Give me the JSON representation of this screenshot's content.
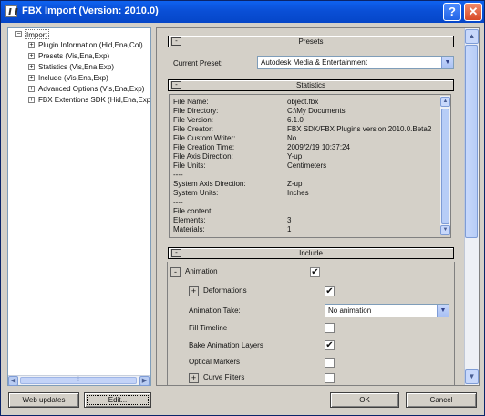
{
  "window": {
    "title": "FBX Import (Version: 2010.0)",
    "help_glyph": "?",
    "close_glyph": "✕"
  },
  "tree": {
    "root": {
      "label": "Import",
      "toggle": "−"
    },
    "items": [
      {
        "label": "Plugin Information (Hid,Ena,Col)",
        "toggle": "+"
      },
      {
        "label": "Presets (Vis,Ena,Exp)",
        "toggle": "+"
      },
      {
        "label": "Statistics (Vis,Ena,Exp)",
        "toggle": "+"
      },
      {
        "label": "Include (Vis,Ena,Exp)",
        "toggle": "+"
      },
      {
        "label": "Advanced Options (Vis,Ena,Exp)",
        "toggle": "+"
      },
      {
        "label": "FBX Extentions SDK (Hid,Ena,Exp",
        "toggle": "+"
      }
    ]
  },
  "presets": {
    "title": "Presets",
    "collapse": "-",
    "current_label": "Current Preset:",
    "current_value": "Autodesk Media & Entertainment"
  },
  "statistics": {
    "title": "Statistics",
    "collapse": "-",
    "rows": [
      {
        "label": "File Name:",
        "value": "object.fbx"
      },
      {
        "label": "File Directory:",
        "value": "C:\\My Documents"
      },
      {
        "label": "File Version:",
        "value": "6.1.0"
      },
      {
        "label": "File Creator:",
        "value": "FBX SDK/FBX Plugins version 2010.0.Beta2"
      },
      {
        "label": "File Custom Writer:",
        "value": "No"
      },
      {
        "label": "File Creation Time:",
        "value": "2009/2/19  10:37:24"
      },
      {
        "label": "File Axis Direction:",
        "value": "Y-up"
      },
      {
        "label": "File Units:",
        "value": "Centimeters"
      },
      {
        "label": "----",
        "value": ""
      },
      {
        "label": "System Axis Direction:",
        "value": "Z-up"
      },
      {
        "label": "System Units:",
        "value": "Inches"
      },
      {
        "label": "----",
        "value": ""
      },
      {
        "label": "File content:",
        "value": ""
      },
      {
        "label": "Elements:",
        "value": "3"
      },
      {
        "label": "Materials:",
        "value": "1"
      }
    ]
  },
  "include": {
    "title": "Include",
    "collapse": "-",
    "animation": {
      "label": "Animation",
      "checked": true,
      "toggle": "-"
    },
    "deformations": {
      "label": "Deformations",
      "checked": true,
      "toggle": "+"
    },
    "animation_take": {
      "label": "Animation Take:",
      "value": "No animation"
    },
    "fill_timeline": {
      "label": "Fill Timeline",
      "checked": false
    },
    "bake_layers": {
      "label": "Bake Animation Layers",
      "checked": true
    },
    "optical_markers": {
      "label": "Optical Markers",
      "checked": false
    },
    "curve_filters": {
      "label": "Curve Filters",
      "checked": false,
      "toggle": "+"
    }
  },
  "buttons": {
    "web_updates": "Web updates",
    "edit": "Edit...",
    "ok": "OK",
    "cancel": "Cancel"
  },
  "glyphs": {
    "check": "✔",
    "down": "▼",
    "up": "▲",
    "left": "◀",
    "right": "▶",
    "grip": "⁞"
  }
}
